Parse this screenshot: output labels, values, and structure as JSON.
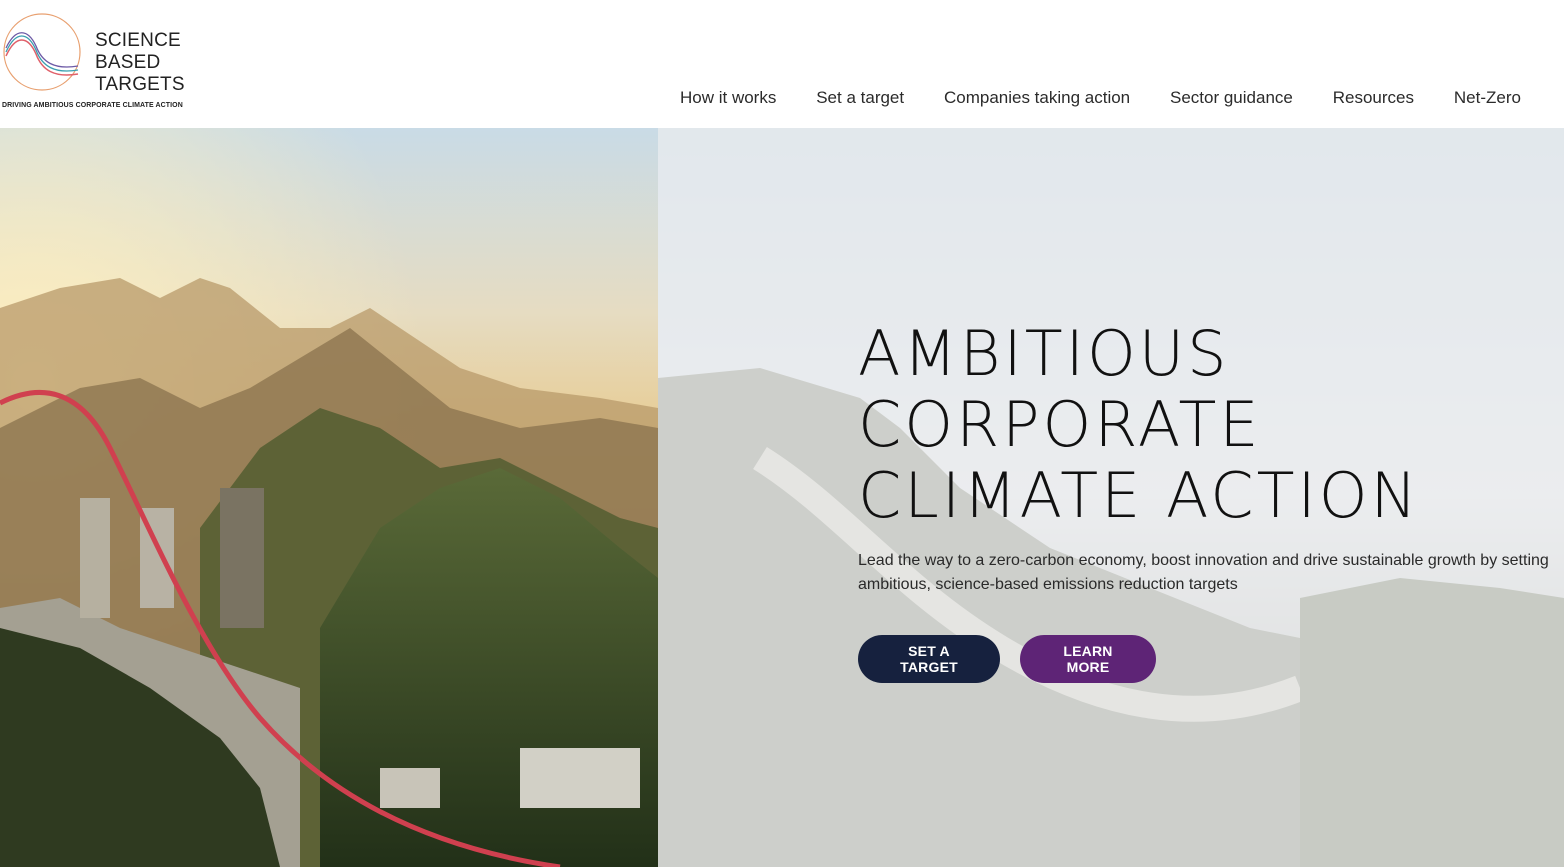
{
  "brand": {
    "line1": "SCIENCE",
    "line2": "BASED",
    "line3": "TARGETS",
    "tagline": "DRIVING AMBITIOUS CORPORATE CLIMATE ACTION",
    "icon": "sbt-curves-logo-icon"
  },
  "nav": {
    "items": [
      {
        "label": "How it works"
      },
      {
        "label": "Set a target"
      },
      {
        "label": "Companies taking action"
      },
      {
        "label": "Sector guidance"
      },
      {
        "label": "Resources"
      },
      {
        "label": "Net-Zero"
      }
    ]
  },
  "hero": {
    "title_line1": "AMBITIOUS",
    "title_line2": "CORPORATE",
    "title_line3": "CLIMATE ACTION",
    "subtitle": "Lead the way to a zero-carbon economy, boost innovation and drive sustainable growth by setting ambitious, science-based emissions reduction targets",
    "primary_button": "SET A TARGET",
    "secondary_button": "LEARN MORE"
  },
  "colors": {
    "primary_button": "#16213e",
    "secondary_button": "#5e2476",
    "curve": "#d0404f"
  }
}
